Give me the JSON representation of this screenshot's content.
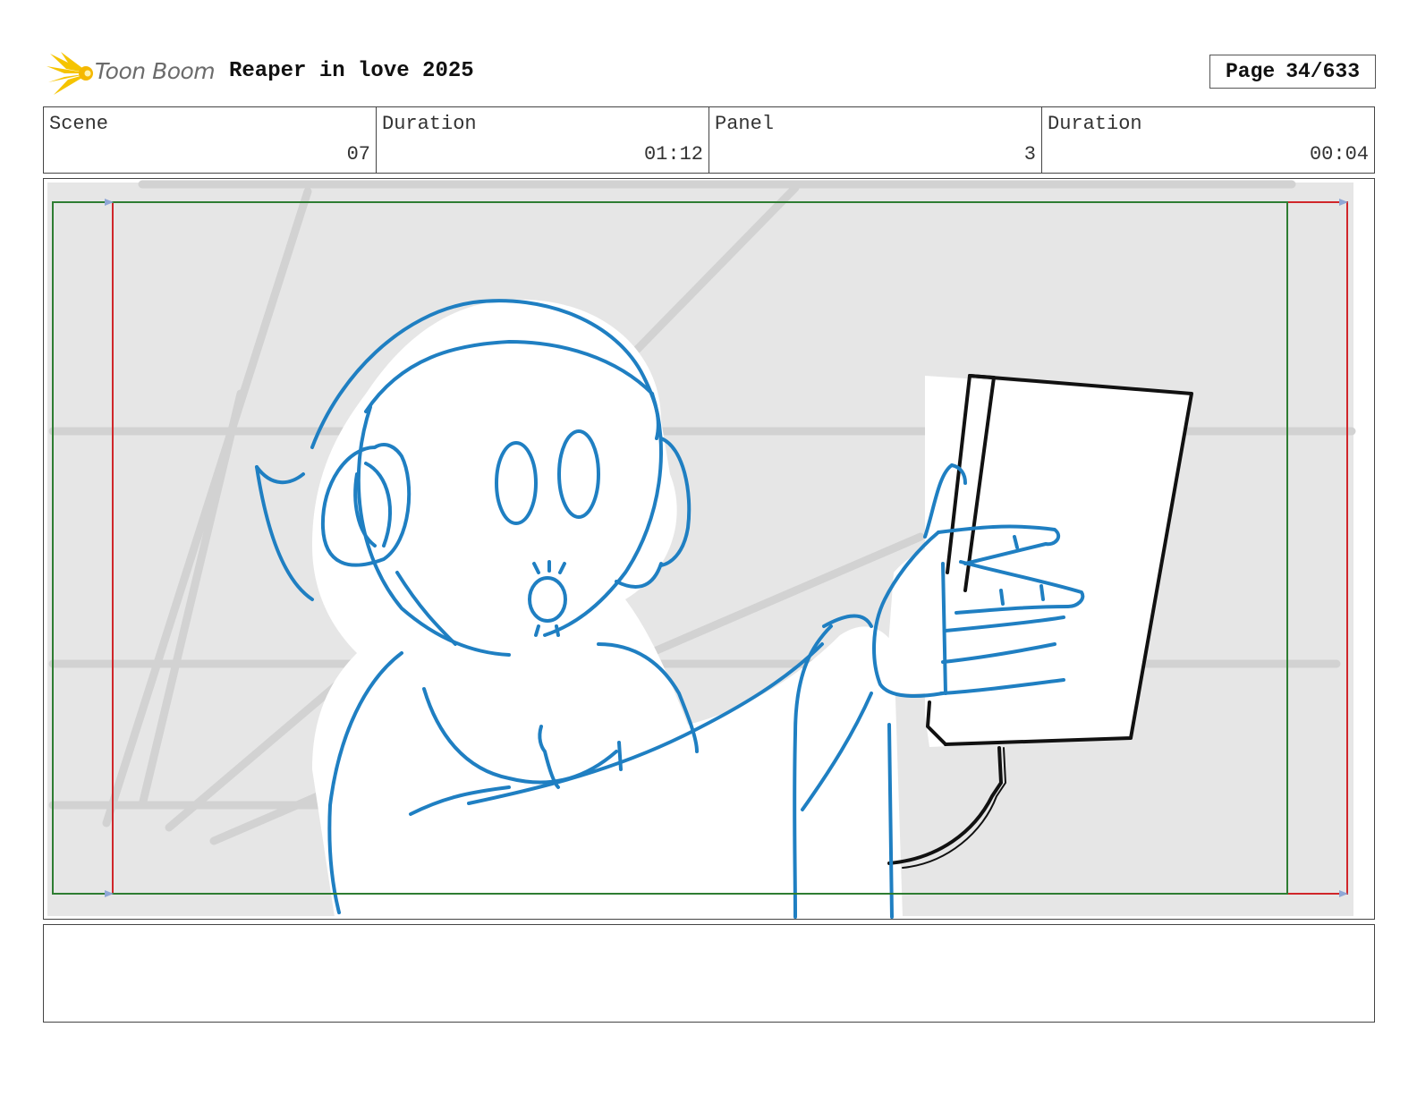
{
  "header": {
    "logo_text": "Toon Boom",
    "project_title": "Reaper in love 2025",
    "page_label": "Page",
    "page_value": "34/633"
  },
  "info": {
    "scene_label": "Scene",
    "scene_value": "07",
    "scene_duration_label": "Duration",
    "scene_duration_value": "01:12",
    "panel_label": "Panel",
    "panel_value": "3",
    "panel_duration_label": "Duration",
    "panel_duration_value": "00:04"
  },
  "notes": {
    "text": ""
  },
  "colors": {
    "sketch_blue": "#1f7fc2",
    "safe_frame_red": "#d0262a",
    "title_safe_green": "#2e7d32",
    "background_gray": "#e6e6e6",
    "logo_yellow": "#f5c400"
  },
  "icons": {
    "logo": "toon-boom-logo-icon"
  }
}
